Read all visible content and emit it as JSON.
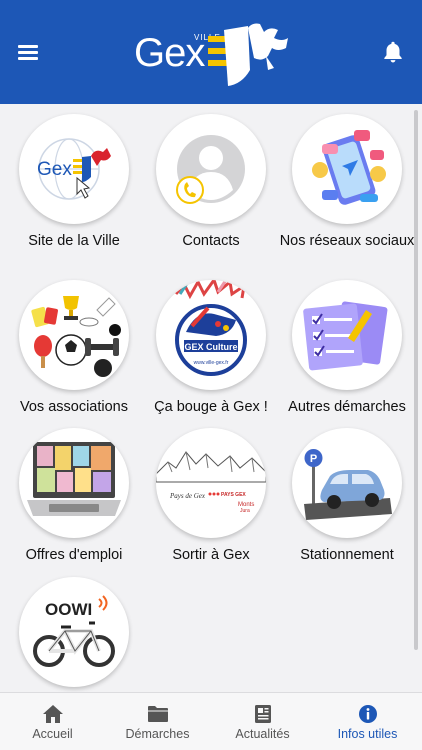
{
  "header": {
    "logo_small": "VILLE DE",
    "logo_text": "Gex",
    "menu_icon": "hamburger-menu-icon",
    "bell_icon": "bell-icon"
  },
  "tiles": [
    {
      "label": "Site de la Ville",
      "icon": "gex-logo-globe"
    },
    {
      "label": "Contacts",
      "icon": "person-phone"
    },
    {
      "label": "Nos réseaux sociaux",
      "icon": "smartphone-social"
    },
    {
      "label": "Vos associations",
      "icon": "sports-equipment"
    },
    {
      "label": "Ça bouge à Gex !",
      "icon": "gex-culture-logo"
    },
    {
      "label": "Autres démarches",
      "icon": "checklist-forms"
    },
    {
      "label": "Offres d'emploi",
      "icon": "laptop-job-offers"
    },
    {
      "label": "Sortir à Gex",
      "icon": "mountains-pays-de-gex"
    },
    {
      "label": "Stationnement",
      "icon": "parking-car"
    },
    {
      "label": "",
      "icon": "oowi-bike"
    }
  ],
  "tile_images": {
    "culture_text": "GEX Culture",
    "culture_url": "www.ville-gex.fr",
    "pays_gex": "PAYS GEX",
    "oowi": "OOWI",
    "parking_letter": "P"
  },
  "tabbar": [
    {
      "label": "Accueil",
      "icon": "home-icon",
      "active": false
    },
    {
      "label": "Démarches",
      "icon": "folder-icon",
      "active": false
    },
    {
      "label": "Actualités",
      "icon": "newspaper-icon",
      "active": false
    },
    {
      "label": "Infos utiles",
      "icon": "info-circle-icon",
      "active": true
    }
  ],
  "colors": {
    "header_blue": "#1d57b6",
    "accent_yellow": "#f5c400",
    "active_tab": "#1d57b6"
  }
}
